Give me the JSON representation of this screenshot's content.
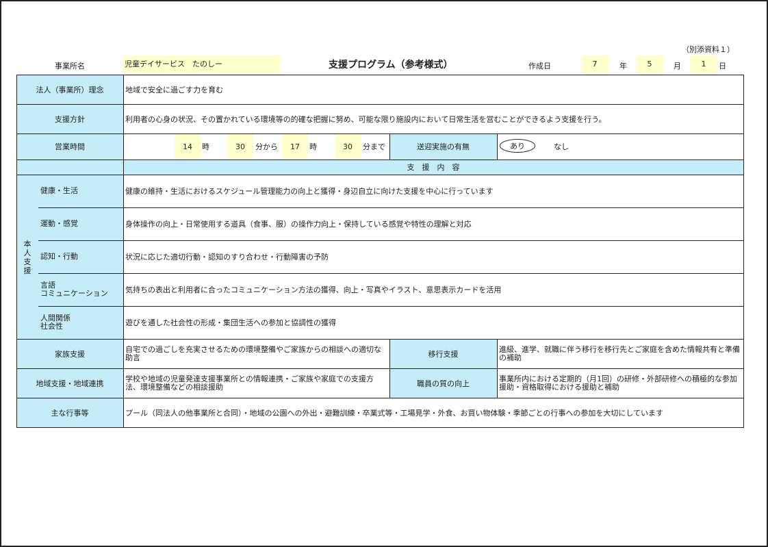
{
  "header": {
    "note": "（別添資料１）",
    "office_label": "事業所名",
    "office_name": "児童デイサービス　たのしー",
    "title": "支援プログラム（参考様式）",
    "created_label": "作成日",
    "year": "7",
    "year_unit": "年",
    "month": "5",
    "month_unit": "月",
    "day": "1",
    "day_unit": "日"
  },
  "philosophy": {
    "label": "法人（事業所）理念",
    "value": "地域で安全に過ごす力を育む"
  },
  "policy": {
    "label": "支援方針",
    "value": "利用者の心身の状況、その置かれている環境等の的確な把握に努め、可能な限り施設内において日常生活を営むことができるよう支援を行う。"
  },
  "hours": {
    "label": "営業時間",
    "start_hour": "14",
    "hour_unit1": "時",
    "start_min": "30",
    "from_unit": "分から",
    "end_hour": "17",
    "hour_unit2": "時",
    "end_min": "30",
    "until_unit": "分まで",
    "transport_label": "送迎実施の有無",
    "option_yes": "あり",
    "option_no": "なし"
  },
  "support_header": "支　援　内　容",
  "personal_support": {
    "group_label": "本人支援",
    "rows": [
      {
        "label": "健康・生活",
        "value": "健康の維持・生活におけるスケジュール管理能力の向上と獲得・身辺自立に向けた支援を中心に行っています"
      },
      {
        "label": "運動・感覚",
        "value": "身体操作の向上・日常使用する道具（食事、服）の操作力向上・保持している感覚や特性の理解と対応"
      },
      {
        "label": "認知・行動",
        "value": "状況に応じた適切行動・認知のすり合わせ・行動障害の予防"
      },
      {
        "label": "言語\nコミュニケーション",
        "value": "気持ちの表出と利用者に合ったコミュニケーション方法の獲得、向上・写真やイラスト、意思表示カードを活用"
      },
      {
        "label": "人間関係\n社会性",
        "value": "遊びを通した社会性の形成・集団生活への参加と協調性の獲得"
      }
    ]
  },
  "family": {
    "label": "家族支援",
    "value": "自宅での過ごしを充実させるための環境整備やご家族からの相談への適切な助言"
  },
  "transition": {
    "label": "移行支援",
    "value": "進級、進学、就職に伴う移行を移行先とご家庭を含めた情報共有と準備の補助"
  },
  "community": {
    "label": "地域支援・地域連携",
    "value": "学校や地域の児童発達支援事業所との情報連携・ご家族や家庭での支援方法、環境整備などの相談援助"
  },
  "staff": {
    "label": "職員の質の向上",
    "value": "事業所内における定期的（月1回）の研修・外部研修への積極的な参加援助・資格取得における援助と補助"
  },
  "events": {
    "label": "主な行事等",
    "value": "プール（同法人の他事業所と合同）・地域の公園への外出・避難訓練・卒業式等・工場見学・外食、お買い物体験・季節ごとの行事への参加を大切にしています"
  },
  "colors": {
    "label_bg": "#c5ecf9",
    "input_bg": "#ffffcc",
    "border": "#222222"
  }
}
